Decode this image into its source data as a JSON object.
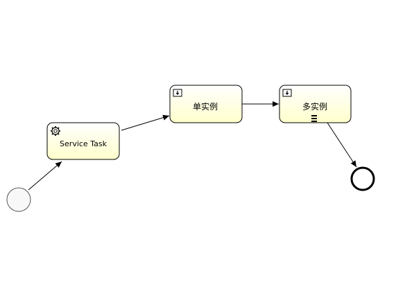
{
  "diagram": {
    "start_event": {},
    "service_task": {
      "label": "Service Task",
      "icon": "gear-icon"
    },
    "single_instance_task": {
      "label": "单实例",
      "icon": "call-activity-marker-icon"
    },
    "multi_instance_task": {
      "label": "多实例",
      "icon": "call-activity-marker-icon",
      "marker": "sequential-multi-instance-icon"
    },
    "end_event": {},
    "colors": {
      "task_fill_top": "#ffffff",
      "task_fill_bottom": "#ffffcc",
      "stroke": "#000000",
      "start_fill": "#f8f8f8"
    }
  }
}
